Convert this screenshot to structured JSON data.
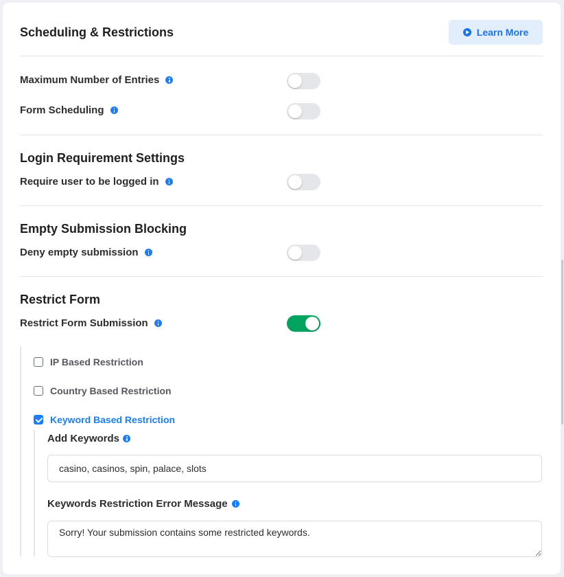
{
  "header": {
    "title": "Scheduling & Restrictions",
    "learn_more_label": "Learn More"
  },
  "scheduling": {
    "max_entries_label": "Maximum Number of Entries",
    "max_entries_enabled": false,
    "form_scheduling_label": "Form Scheduling",
    "form_scheduling_enabled": false
  },
  "login": {
    "title": "Login Requirement Settings",
    "require_login_label": "Require user to be logged in",
    "require_login_enabled": false
  },
  "empty_submission": {
    "title": "Empty Submission Blocking",
    "deny_label": "Deny empty submission",
    "deny_enabled": false
  },
  "restrict_form": {
    "title": "Restrict Form",
    "restrict_submission_label": "Restrict Form Submission",
    "restrict_submission_enabled": true,
    "options": [
      {
        "label": "IP Based Restriction",
        "checked": false
      },
      {
        "label": "Country Based Restriction",
        "checked": false
      },
      {
        "label": "Keyword Based Restriction",
        "checked": true
      }
    ],
    "keywords": {
      "add_label": "Add Keywords",
      "value": "casino, casinos, spin, palace, slots",
      "error_label": "Keywords Restriction Error Message",
      "error_value": "Sorry! Your submission contains some restricted keywords."
    }
  },
  "colors": {
    "accent": "#1a7efb",
    "toggle_on": "#00a45f",
    "toggle_off": "#e4e6ea"
  }
}
